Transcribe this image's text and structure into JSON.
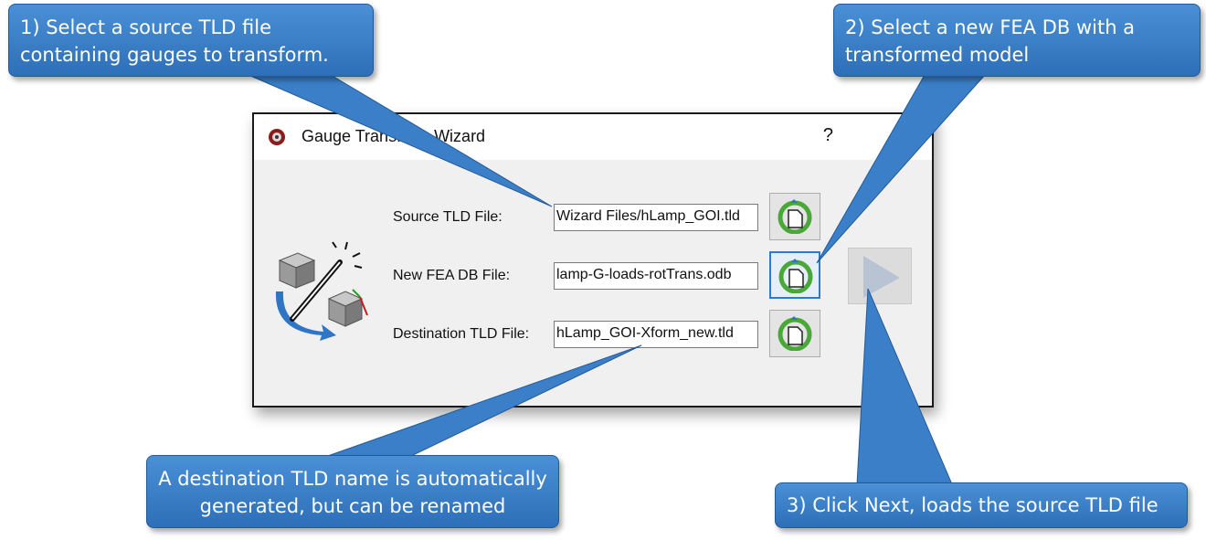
{
  "dialog": {
    "title": "Gauge Transform Wizard",
    "help_label": "?",
    "rows": [
      {
        "label": "Source TLD File:",
        "value": "Wizard Files/hLamp_GOI.tld"
      },
      {
        "label": "New FEA DB File:",
        "value": "lamp-G-loads-rotTrans.odb"
      },
      {
        "label": "Destination TLD File:",
        "value": "hLamp_GOI-Xform_new.tld"
      }
    ],
    "browse_icon": "file-browse-icon",
    "next_icon": "play-arrow-icon"
  },
  "callouts": {
    "step1": "1) Select a source TLD file containing gauges to transform.",
    "step2": "2) Select a new FEA DB with a transformed model",
    "destination": "A destination TLD name is automatically generated, but can be renamed",
    "step3": "3) Click Next, loads the source TLD file"
  },
  "colors": {
    "callout_fill": "#3a7fc8",
    "focus_border": "#2a7bd4",
    "dialog_bg": "#f0f0f0"
  }
}
